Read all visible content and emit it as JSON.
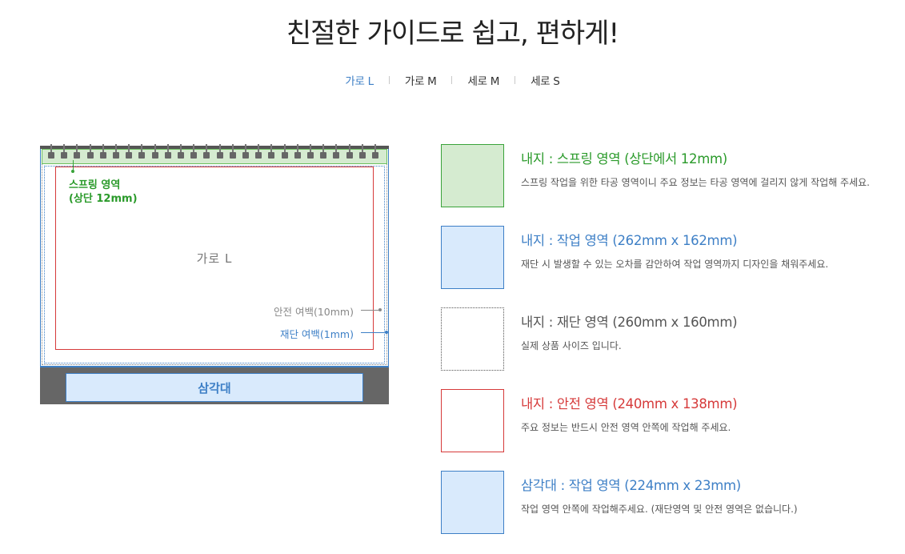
{
  "header": {
    "title": "친절한 가이드로 쉽고, 편하게!"
  },
  "tabs": [
    {
      "label": "가로 L",
      "active": true
    },
    {
      "label": "가로 M",
      "active": false
    },
    {
      "label": "세로 M",
      "active": false
    },
    {
      "label": "세로 S",
      "active": false
    }
  ],
  "diagram": {
    "spring_label_line1": "스프링 영역",
    "spring_label_line2": "(상단 12mm)",
    "center_label": "가로  L",
    "safe_margin_label": "안전 여백(10mm)",
    "bleed_margin_label": "재단 여백(1mm)",
    "stand_label": "삼각대"
  },
  "legend": [
    {
      "title": "내지 : 스프링 영역 (상단에서 12mm)",
      "desc": "스프링 작업을 위한 타공 영역이니 주요 정보는 타공 영역에 걸리지 않게 작업해 주세요.",
      "color": "#2a9a2a"
    },
    {
      "title": "내지 : 작업 영역 (262mm x 162mm)",
      "desc": "재단 시 발생할 수 있는 오차를 감안하여 작업 영역까지 디자인을 채워주세요.",
      "color": "#3d7fc6"
    },
    {
      "title": "내지 : 재단 영역 (260mm x 160mm)",
      "desc": "실제 상품 사이즈 입니다.",
      "color": "#555555"
    },
    {
      "title": "내지 : 안전 영역 (240mm x 138mm)",
      "desc": "주요 정보는 반드시 안전 영역 안쪽에 작업해 주세요.",
      "color": "#d63a3a"
    },
    {
      "title": "삼각대 : 작업 영역 (224mm x 23mm)",
      "desc": "작업 영역 안쪽에 작업해주세요. (재단영역 및 안전 영역은 없습니다.)",
      "color": "#3d7fc6"
    }
  ]
}
